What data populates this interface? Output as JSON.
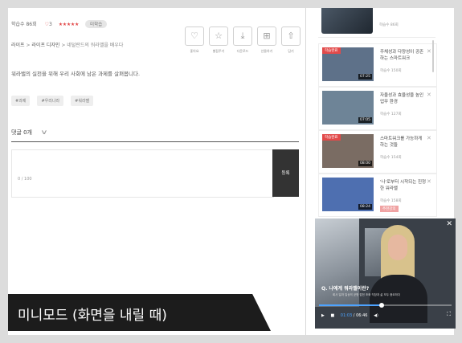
{
  "course": {
    "learners": "학습수 86회",
    "likes": "3",
    "rating_stars": "★★★★★",
    "status_badge": "미학습",
    "breadcrumb_1": "라이프",
    "breadcrumb_2": "라이프 디자인",
    "breadcrumb_3": "네덜란드의 워라밸을 배우다",
    "description": "워라밸의 실천을 위해 우리 사회에 남은 과제를 살펴봅니다.",
    "tags": [
      "#과제",
      "#우리나라",
      "#워라밸"
    ]
  },
  "actions": [
    {
      "icon": "heart-outline-icon",
      "glyph": "♡",
      "label": "좋아요"
    },
    {
      "icon": "star-outline-icon",
      "glyph": "☆",
      "label": "별점주기"
    },
    {
      "icon": "download-icon",
      "glyph": "⤓",
      "label": "다운로드"
    },
    {
      "icon": "gift-icon",
      "glyph": "⊞",
      "label": "선물하기"
    },
    {
      "icon": "share-icon",
      "glyph": "⇧",
      "label": "담기"
    }
  ],
  "comments": {
    "header": "댓글 0개",
    "counter": "0 / 100",
    "submit_label": "등록"
  },
  "sidebar": {
    "top_views": "학습수 86회",
    "items": [
      {
        "flag": "학습완료",
        "duration": "07:25",
        "title": "주체성과 다양성이 공존하는 스마트워크",
        "views": "학습수 150회",
        "thumb": "#5e7189"
      },
      {
        "flag": "",
        "duration": "07:05",
        "title": "자율성과 효율성을 높인 업무 환경",
        "views": "학습수 127회",
        "thumb": "#6e8497"
      },
      {
        "flag": "학습완료",
        "duration": "08:00",
        "title": "스마트워크를 가능하게 하는 것들",
        "views": "학습수 154회",
        "thumb": "#7a6c63"
      },
      {
        "flag": "",
        "duration": "08:24",
        "title": "'나'로부터 시작되는 진정한 워라밸",
        "views": "학습수 158회",
        "thumb": "#4e6fb0",
        "new": "추천강의"
      }
    ]
  },
  "mini_player": {
    "question": "Q. 나에게 워라밸이란?",
    "subtitle": "회사 일과 일상의 균형 잡힌 조화 직장과 삶 모두 중요하다",
    "current_time": "01:03",
    "total_time": "/ 06:46",
    "progress": 0.47
  },
  "caption": "미니모드 (화면을 내릴 때)"
}
